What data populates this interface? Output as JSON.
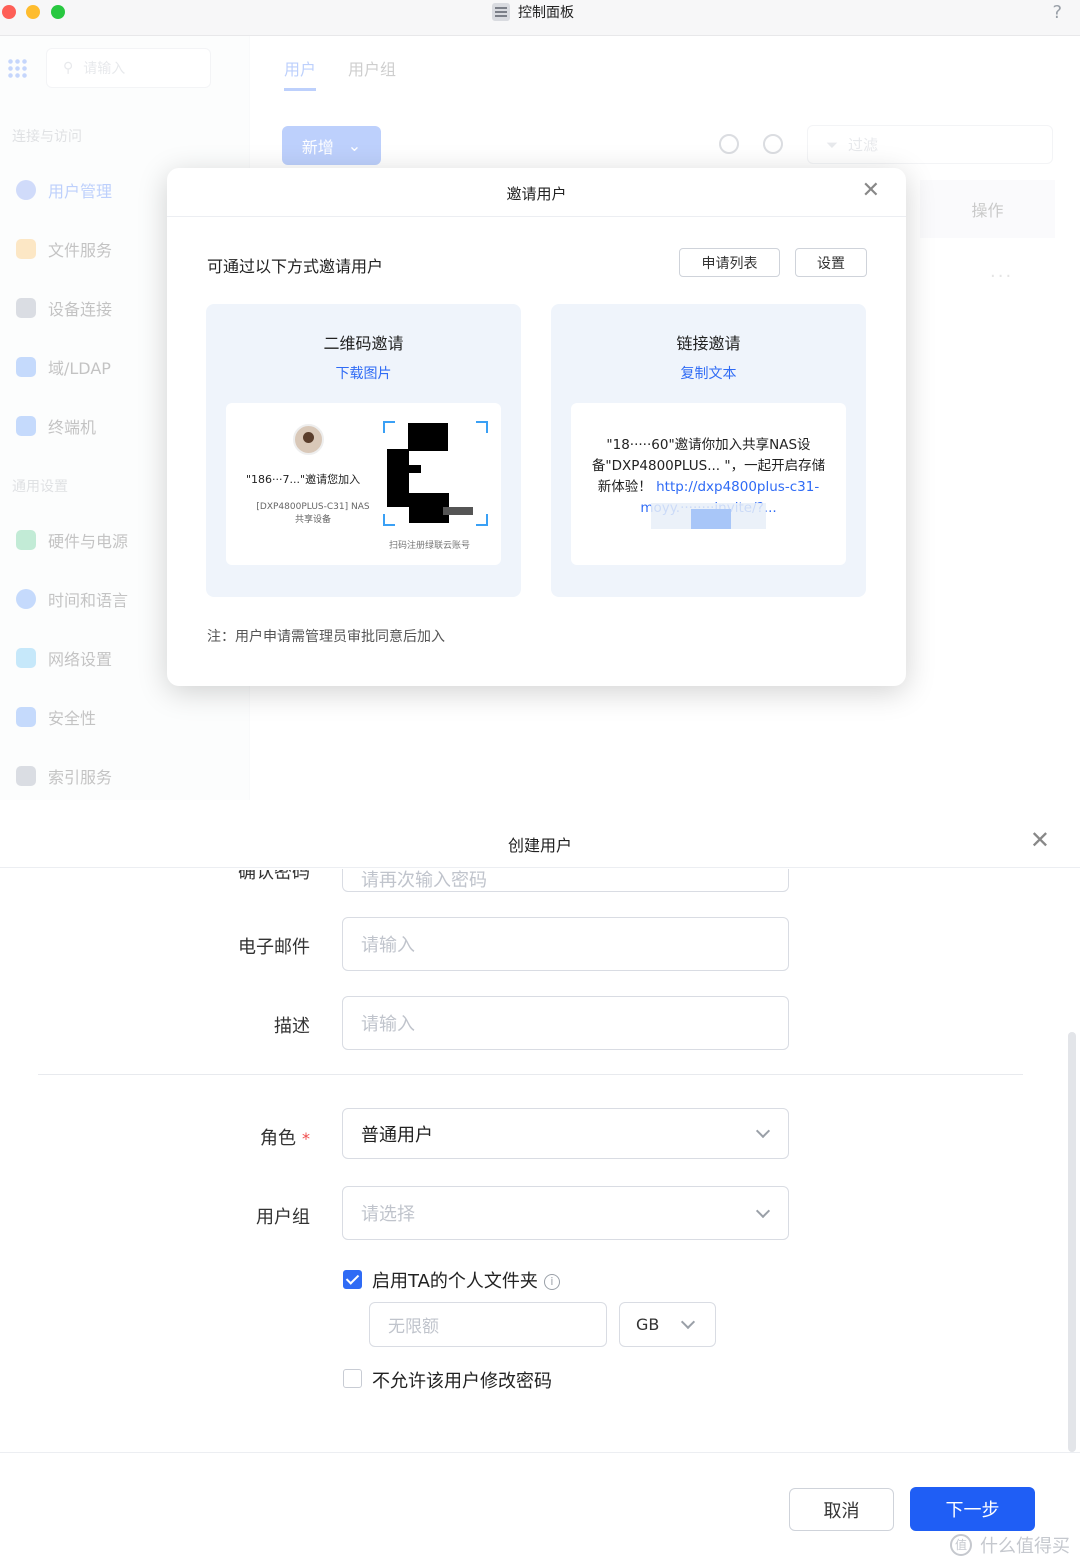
{
  "window": {
    "title": "控制面板",
    "help_label": "?"
  },
  "sidebar": {
    "search_placeholder": "请输入",
    "section_access": "连接与访问",
    "section_general": "通用设置",
    "items": [
      {
        "label": "用户管理",
        "icon": "user-icon"
      },
      {
        "label": "文件服务",
        "icon": "folder-icon"
      },
      {
        "label": "设备连接",
        "icon": "device-icon"
      },
      {
        "label": "域/LDAP",
        "icon": "domain-icon"
      },
      {
        "label": "终端机",
        "icon": "terminal-icon"
      },
      {
        "label": "硬件与电源",
        "icon": "power-icon"
      },
      {
        "label": "时间和语言",
        "icon": "clock-icon"
      },
      {
        "label": "网络设置",
        "icon": "network-icon"
      },
      {
        "label": "安全性",
        "icon": "shield-icon"
      },
      {
        "label": "索引服务",
        "icon": "index-icon"
      }
    ]
  },
  "main": {
    "tabs": [
      "用户",
      "用户组"
    ],
    "add_button": "新增",
    "filter_placeholder": "过滤",
    "ops_header": "操作",
    "more": "···"
  },
  "invite_modal": {
    "title": "邀请用户",
    "lead": "可通过以下方式邀请用户",
    "apply_list_button": "申请列表",
    "settings_button": "设置",
    "qr_card": {
      "title": "二维码邀请",
      "link": "下载图片",
      "invite_line": "\"186···7...\"邀请您加入",
      "device_line": "[DXP4800PLUS-C31] NAS",
      "device_line2": "共享设备",
      "caption": "扫码注册绿联云账号"
    },
    "link_card": {
      "title": "链接邀请",
      "link": "复制文本",
      "text": "\"18·····60\"邀请你加入共享NAS设备\"DXP4800PLUS... \"，一起开启存储新体验！",
      "url": "http://dxp4800plus-c31-moyy.········invite/?..."
    },
    "note": "注：用户申请需管理员审批同意后加入"
  },
  "create_dialog": {
    "title": "创建用户",
    "confirm_password_label": "确认密码",
    "confirm_password_placeholder": "请再次输入密码",
    "email_label": "电子邮件",
    "email_placeholder": "请输入",
    "desc_label": "描述",
    "desc_placeholder": "请输入",
    "role_label": "角色",
    "role_required": "*",
    "role_value": "普通用户",
    "group_label": "用户组",
    "group_placeholder": "请选择",
    "personal_folder_label": "启用TA的个人文件夹",
    "personal_folder_checked": true,
    "quota_placeholder": "无限额",
    "quota_unit": "GB",
    "no_change_password_label": "不允许该用户修改密码",
    "no_change_password_checked": false,
    "cancel_button": "取消",
    "next_button": "下一步"
  },
  "watermark": "什么值得买"
}
